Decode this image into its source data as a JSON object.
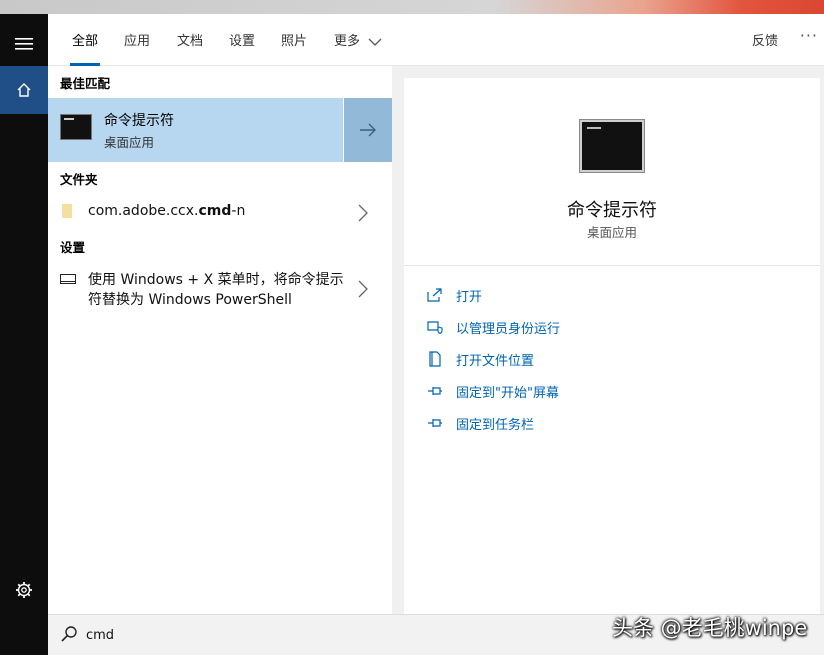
{
  "header": {
    "tabs": [
      {
        "label": "全部"
      },
      {
        "label": "应用"
      },
      {
        "label": "文档"
      },
      {
        "label": "设置"
      },
      {
        "label": "照片"
      },
      {
        "label": "更多"
      }
    ],
    "active_tab": "全部",
    "feedback_label": "反馈",
    "more_options": "···"
  },
  "sidebar": {
    "icons": [
      "hamburger-menu-icon",
      "home-icon",
      "gear-icon"
    ]
  },
  "results": {
    "best_match": {
      "title": "最佳匹配",
      "name": "命令提示符",
      "subtitle": "桌面应用"
    },
    "folders": {
      "title": "文件夹",
      "item": {
        "prefix": "com.adobe.ccx.",
        "bold": "cmd",
        "suffix": "-n"
      }
    },
    "settings": {
      "title": "设置",
      "item": "使用 Windows + X 菜单时，将命令提示符替换为 Windows PowerShell"
    }
  },
  "preview": {
    "name": "命令提示符",
    "subtitle": "桌面应用",
    "actions": [
      {
        "label": "打开",
        "icon": "open-icon"
      },
      {
        "label": "以管理员身份运行",
        "icon": "shield-icon"
      },
      {
        "label": "打开文件位置",
        "icon": "file-location-icon"
      },
      {
        "label": "固定到\"开始\"屏幕",
        "icon": "pin-icon"
      },
      {
        "label": "固定到任务栏",
        "icon": "pin-icon"
      }
    ]
  },
  "search": {
    "value": "cmd"
  },
  "watermark": "头条 @老毛桃winpe",
  "colors": {
    "accent": "#0063b1",
    "selected_row": "#b7d7f1",
    "rail": "#0d0d0d",
    "home_active": "#1f4f86"
  }
}
